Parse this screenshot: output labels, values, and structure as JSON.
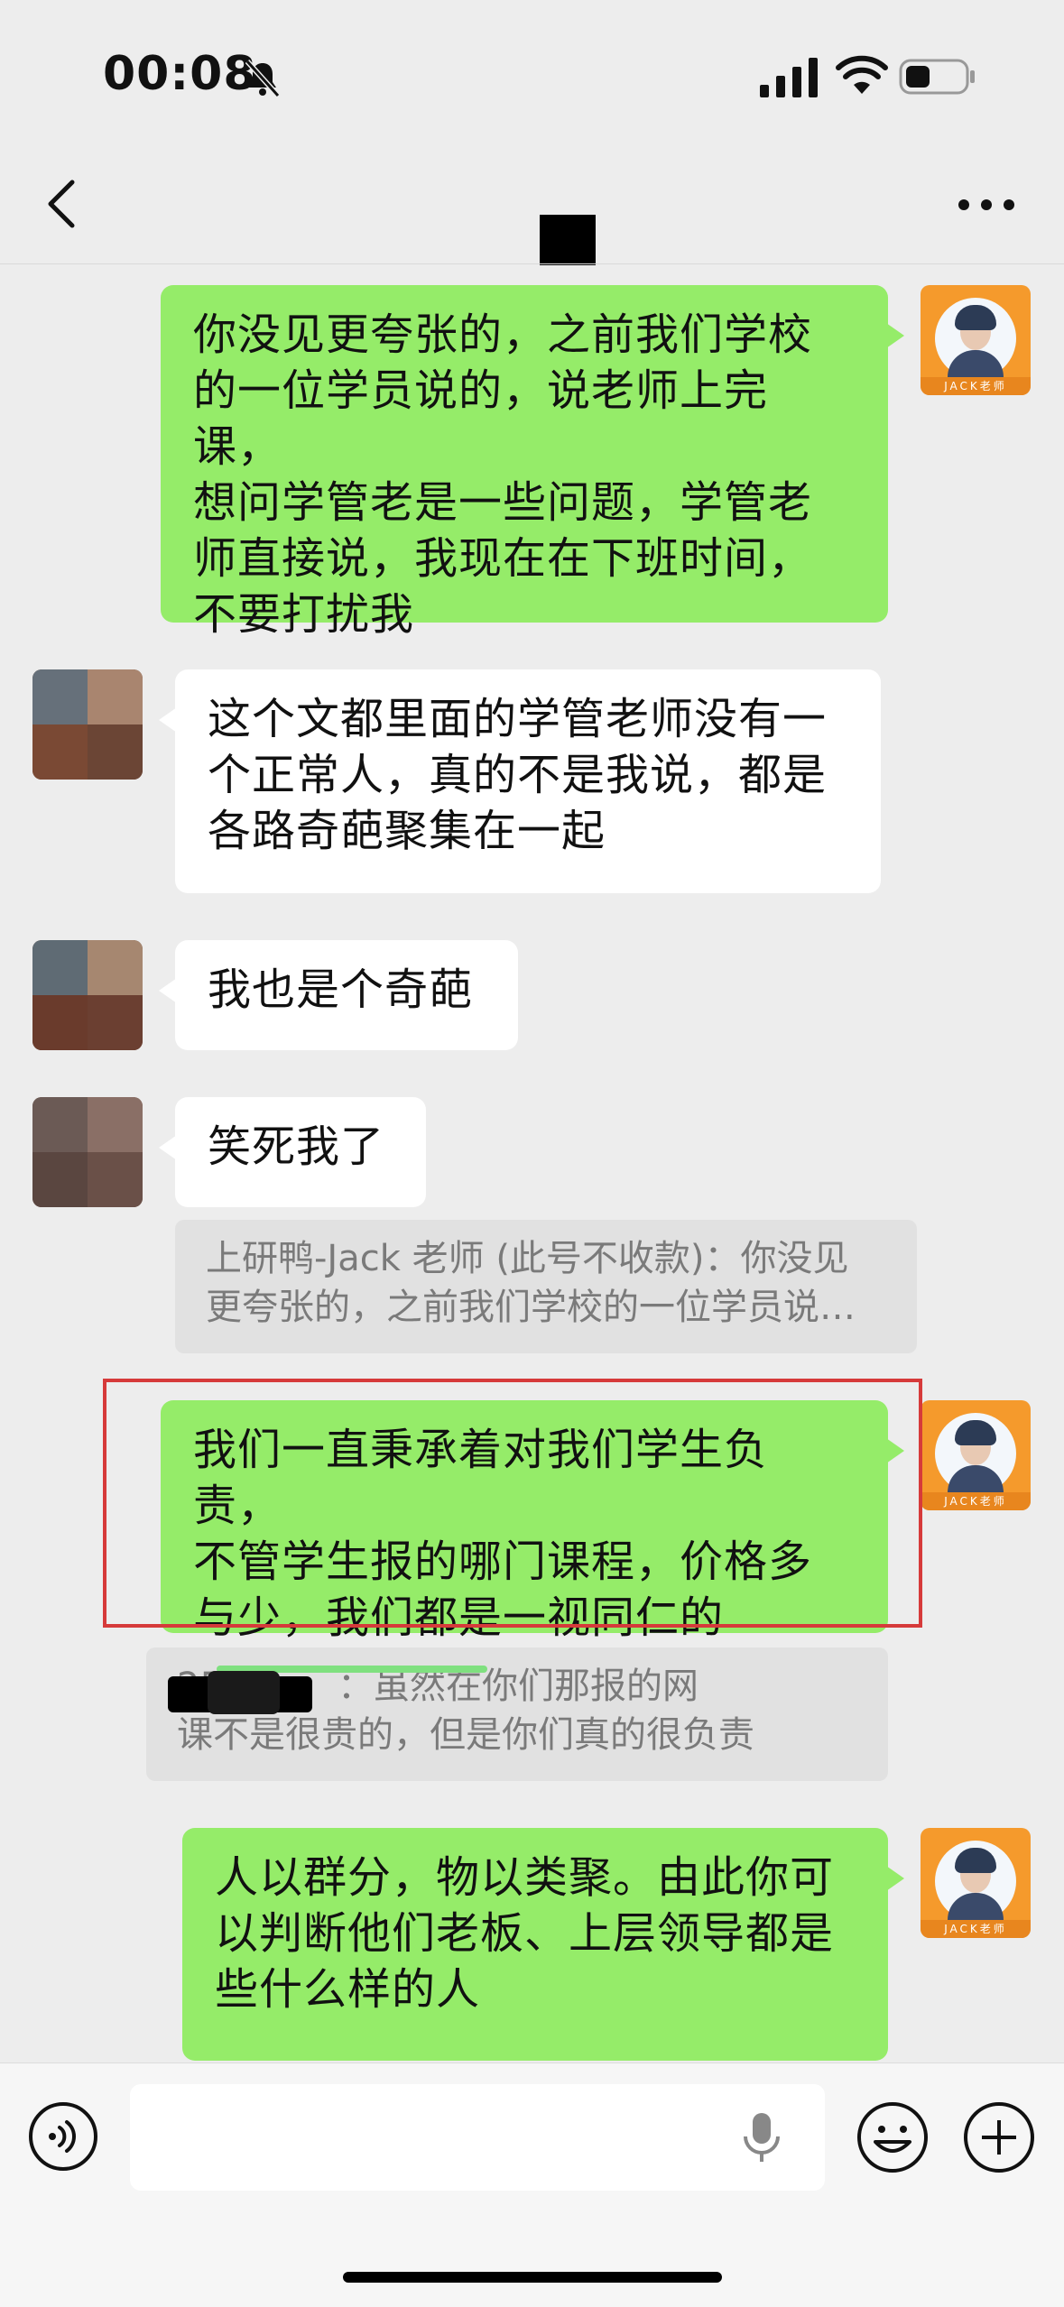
{
  "status_bar": {
    "time": "00:08"
  },
  "messages": [
    {
      "from": "me",
      "text": "你没见更夸张的，之前我们学校\n的一位学员说的，说老师上完课，\n想问学管老是一些问题，学管老\n师直接说，我现在在下班时间，\n不要打扰我"
    },
    {
      "from": "other",
      "text": "这个文都里面的学管老师没有一\n个正常人，真的不是我说，都是\n各路奇葩聚集在一起"
    },
    {
      "from": "other",
      "text": "我也是个奇葩"
    },
    {
      "from": "other",
      "text": "笑死我了",
      "quote": "上研鸭-Jack 老师 (此号不收款)：你没见\n更夸张的，之前我们学校的一位学员说…"
    },
    {
      "from": "me",
      "text": "我们一直秉承着对我们学生负责，\n不管学生报的哪门课程，价格多\n与少，我们都是一视同仁的",
      "quote": "25          ：虽然在你们那报的网\n课不是很贵的，但是你们真的很负责"
    },
    {
      "from": "me",
      "text": "人以群分，物以类聚。由此你可\n以判断他们老板、上层领导都是\n些什么样的人"
    }
  ],
  "avatar_me_label": "JACK老师",
  "colors": {
    "me_bubble": "#95ec69",
    "other_bubble": "#ffffff",
    "highlight": "#d63a3a"
  }
}
